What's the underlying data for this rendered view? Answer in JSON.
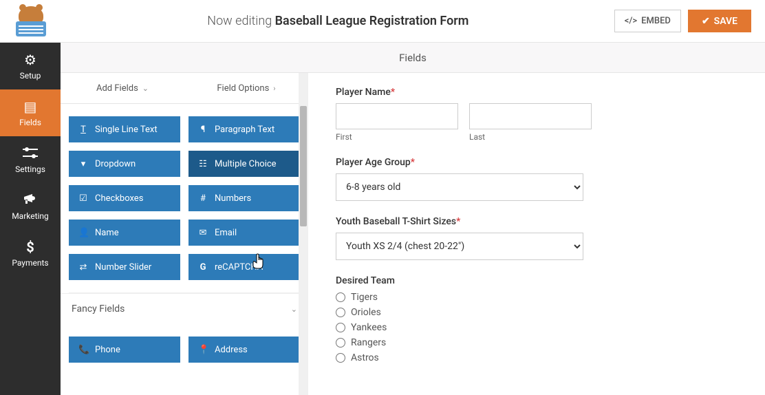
{
  "header": {
    "title_prefix": "Now editing ",
    "title_form": "Baseball League Registration Form",
    "embed_label": "EMBED",
    "save_label": "SAVE"
  },
  "sidebar": {
    "items": [
      {
        "label": "Setup",
        "icon": "⚙"
      },
      {
        "label": "Fields",
        "icon": "▤"
      },
      {
        "label": "Settings",
        "icon": "⚙"
      },
      {
        "label": "Marketing",
        "icon": "📣"
      },
      {
        "label": "Payments",
        "icon": "$"
      }
    ]
  },
  "section_title": "Fields",
  "panel_tabs": {
    "add_fields": "Add Fields",
    "field_options": "Field Options"
  },
  "standard_fields": [
    {
      "label": "Single Line Text",
      "icon": "T"
    },
    {
      "label": "Paragraph Text",
      "icon": "¶"
    },
    {
      "label": "Dropdown",
      "icon": "▾"
    },
    {
      "label": "Multiple Choice",
      "icon": "☷"
    },
    {
      "label": "Checkboxes",
      "icon": "☑"
    },
    {
      "label": "Numbers",
      "icon": "#"
    },
    {
      "label": "Name",
      "icon": "👤"
    },
    {
      "label": "Email",
      "icon": "✉"
    },
    {
      "label": "Number Slider",
      "icon": "⇄"
    },
    {
      "label": "reCAPTCHA",
      "icon": "G"
    }
  ],
  "fancy_section": "Fancy Fields",
  "fancy_fields": [
    {
      "label": "Phone",
      "icon": "📞"
    },
    {
      "label": "Address",
      "icon": "📍"
    }
  ],
  "form": {
    "player_name": {
      "label": "Player Name",
      "first": "First",
      "last": "Last"
    },
    "age_group": {
      "label": "Player Age Group",
      "value": "6-8 years old"
    },
    "tshirt": {
      "label": "Youth Baseball T-Shirt Sizes",
      "value": "Youth XS  2/4 (chest 20-22\")"
    },
    "team": {
      "label": "Desired Team",
      "options": [
        "Tigers",
        "Orioles",
        "Yankees",
        "Rangers",
        "Astros"
      ]
    }
  }
}
